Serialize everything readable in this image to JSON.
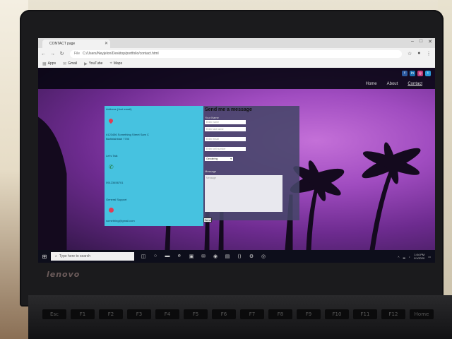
{
  "browser": {
    "tab_title": "CONTACT page",
    "url_lead": "File",
    "url": "C:/Users/Neyjelon/Desktop/portfolio/contact.html",
    "bookmarks": [
      {
        "icon": "apps-icon",
        "label": "Apps"
      },
      {
        "icon": "gmail-icon",
        "label": "Gmail"
      },
      {
        "icon": "youtube-icon",
        "label": "YouTube"
      },
      {
        "icon": "maps-icon",
        "label": "Maps"
      }
    ]
  },
  "site": {
    "social": [
      {
        "icon": "facebook-icon",
        "glyph": "f",
        "color": "#2c5aa0"
      },
      {
        "icon": "linkedin-icon",
        "glyph": "in",
        "color": "#1c6fb0"
      },
      {
        "icon": "instagram-icon",
        "glyph": "◎",
        "color": "#c23a78"
      },
      {
        "icon": "twitter-icon",
        "glyph": "t",
        "color": "#2a9ad8"
      }
    ],
    "nav": [
      "Home",
      "About",
      "Contact"
    ]
  },
  "info": {
    "address_heading": "Address (Just email)",
    "address_line1": "#123456 Something Street Sam C",
    "address_line2": "Blahblahblah 7700",
    "call_heading": "Let's Talk",
    "phone": "09123456701",
    "email_heading": "General Support",
    "email": "something@gmail.com"
  },
  "form": {
    "title": "Send me a message",
    "name_label": "Your Name",
    "first_name_placeholder": "Enter name",
    "last_name_placeholder": "Enter last name",
    "email_placeholder": "Enter email",
    "phone_placeholder": "Enter cell number",
    "select_value": "Gendering",
    "message_label": "Message",
    "message_placeholder": "Message",
    "send_label": "Send"
  },
  "taskbar": {
    "search_placeholder": "Type here to search",
    "time": "1:04 PM",
    "date": "1/1/2020"
  },
  "laptop": {
    "brand": "lenovo"
  },
  "keyboard": {
    "keys": [
      "Esc",
      "F1",
      "F2",
      "F3",
      "F4",
      "F5",
      "F6",
      "F7",
      "F8",
      "F9",
      "F10",
      "F11",
      "F12",
      "Home"
    ]
  }
}
